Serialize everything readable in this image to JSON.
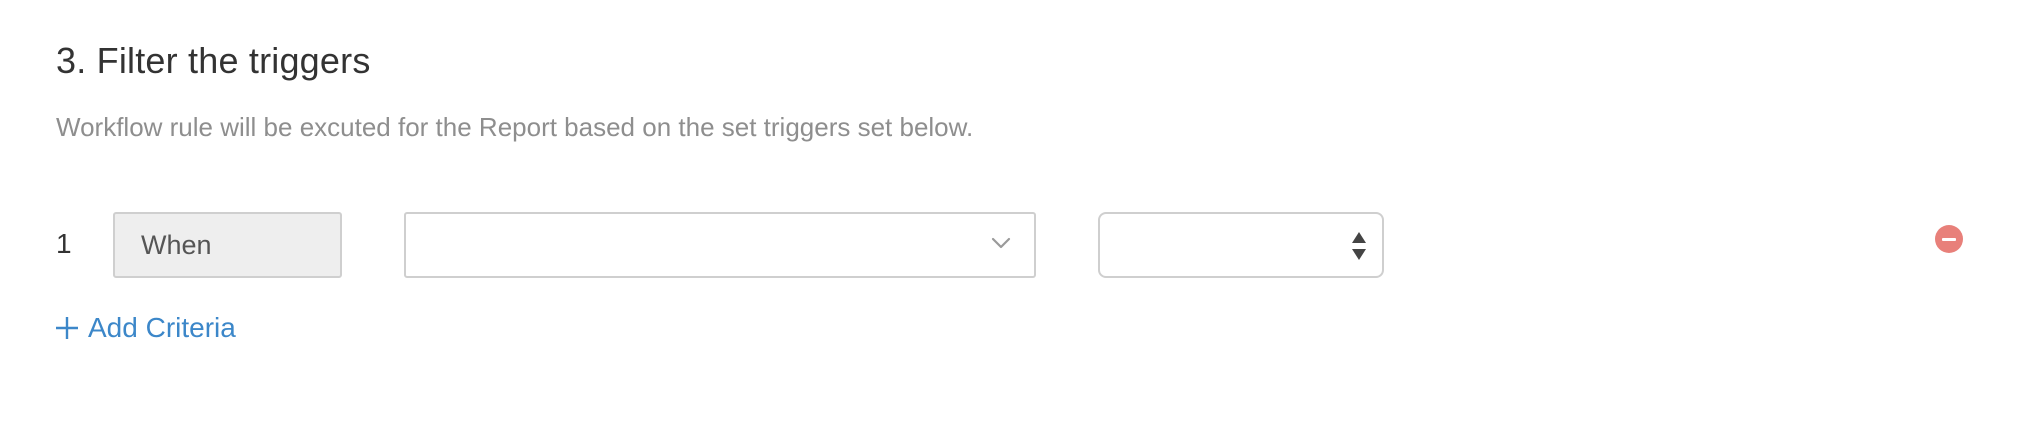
{
  "section": {
    "title": "3. Filter the triggers",
    "subtitle": "Workflow rule will be excuted for the Report based on the set triggers set below."
  },
  "criteria": [
    {
      "index": "1",
      "when_label": "When",
      "field_value": "",
      "operator_value": ""
    }
  ],
  "actions": {
    "add_criteria_label": "Add Criteria"
  },
  "icons": {
    "chevron": "chevron-down-icon",
    "spinner": "up-down-arrows-icon",
    "remove": "minus-circle-icon",
    "add": "plus-icon"
  },
  "colors": {
    "link": "#3c87c9",
    "remove": "#e8807a",
    "border": "#cfcfcf",
    "when_bg": "#eeeeee"
  }
}
